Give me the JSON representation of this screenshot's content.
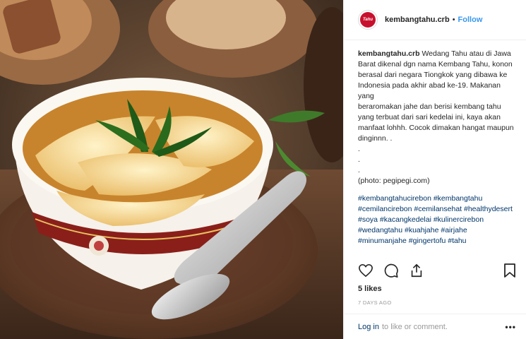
{
  "account": {
    "username": "kembangtahu.crb",
    "separator": "•",
    "follow_label": "Follow",
    "avatar_text": "Tahu"
  },
  "post": {
    "caption_user": "kembangtahu.crb",
    "caption_text": " Wedang Tahu atau di Jawa Barat dikenal dgn nama Kembang Tahu, konon berasal dari negara Tiongkok yang dibawa ke Indonesia pada akhir abad ke-19. Makanan yang\nberaromakan jahe dan berisi kembang tahu yang terbuat dari sari kedelai ini, kaya akan manfaat lohhh. Cocok dimakan hangat maupun dinginnn. .\n.\n.\n.\n(photo: pegipegi.com)",
    "hashtags": "#kembangtahucirebon #kembangtahu #cemilancirebon #cemilansehat #healthydesert #soya #kacangkedelai #kulinercirebon #wedangtahu #kuahjahe #airjahe #minumanjahe #gingertofu #tahu",
    "likes": "5 likes",
    "time_ago": "7 DAYS AGO"
  },
  "footer": {
    "login_link": "Log in",
    "login_rest": "to like or comment.",
    "more_label": "•••"
  },
  "icons": {
    "like": "heart-icon",
    "comment": "comment-icon",
    "share": "share-icon",
    "save": "bookmark-icon"
  },
  "colors": {
    "link_blue": "#3897f0",
    "hashtag": "#003569",
    "brand_red": "#c8102e"
  }
}
